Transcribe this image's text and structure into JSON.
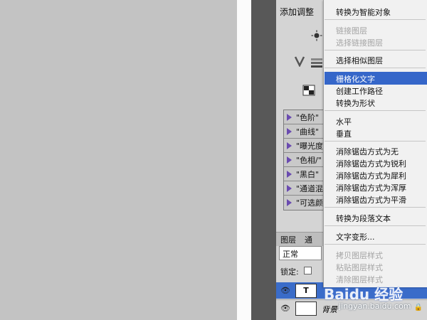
{
  "adjust_panel": {
    "title": "添加调整",
    "presets": [
      "\"色阶\"",
      "\"曲线\"",
      "\"曝光度\"",
      "\"色相/\"",
      "\"黑白\"",
      "\"通道混\"",
      "\"可选颜\""
    ]
  },
  "context_menu": {
    "items": [
      {
        "label": "转换为智能对象",
        "disabled": false
      },
      {
        "label": "链接图层",
        "disabled": true
      },
      {
        "label": "选择链接图层",
        "disabled": true
      },
      {
        "label": "选择相似图层",
        "disabled": false
      },
      {
        "label": "栅格化文字",
        "disabled": false,
        "highlighted": true
      },
      {
        "label": "创建工作路径",
        "disabled": false
      },
      {
        "label": "转换为形状",
        "disabled": false
      },
      {
        "label": "水平",
        "disabled": false
      },
      {
        "label": "垂直",
        "disabled": false
      },
      {
        "label": "消除锯齿方式为无",
        "disabled": false
      },
      {
        "label": "消除锯齿方式为锐利",
        "disabled": false
      },
      {
        "label": "消除锯齿方式为犀利",
        "disabled": false
      },
      {
        "label": "消除锯齿方式为浑厚",
        "disabled": false
      },
      {
        "label": "消除锯齿方式为平滑",
        "disabled": false
      },
      {
        "label": "转换为段落文本",
        "disabled": false
      },
      {
        "label": "文字变形...",
        "disabled": false
      },
      {
        "label": "拷贝图层样式",
        "disabled": true
      },
      {
        "label": "粘贴图层样式",
        "disabled": true
      },
      {
        "label": "清除图层样式",
        "disabled": true
      }
    ]
  },
  "layers_panel": {
    "tab_label": "图层",
    "tab_label_2": "通",
    "blend_mode": "正常",
    "lock_label": "锁定:",
    "layers": [
      {
        "thumb": "T",
        "name": "",
        "selected": true
      },
      {
        "thumb": "",
        "name": "背景",
        "selected": false
      }
    ]
  },
  "watermark": {
    "brand": "Baidu 经验",
    "url": "jingyan.baidu.com"
  },
  "colors": {
    "highlight": "#3566c9",
    "selected_layer": "#3a6cc9",
    "panel": "#d4d4d4",
    "canvas": "#c3c3c3"
  }
}
